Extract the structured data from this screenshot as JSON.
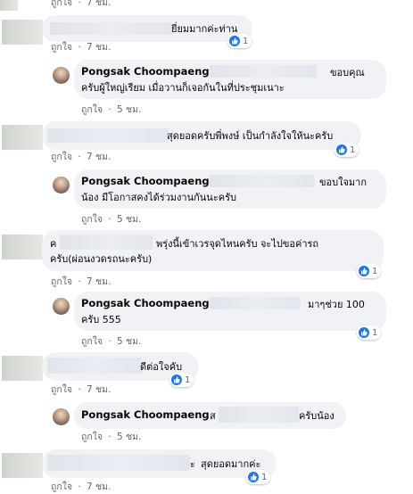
{
  "actions": {
    "like": "ถูกใจ",
    "dot": "·"
  },
  "comments": [
    {
      "type": "top",
      "text": "ยี่ยมมากค่ะท่าน",
      "time": "7 ชม.",
      "reactions": "1"
    },
    {
      "type": "reply",
      "name": "Pongsak Choompaeng",
      "line1": "ขอบคุณ",
      "line2": "ครับผู้ใหญ่เรียม เมื่อวานก็เจอกันในที่ประชุมเนาะ",
      "time": "5 ชม."
    },
    {
      "type": "top",
      "text": "สุดยอดครับพี่พงษ์ เป็นกำลังใจให้นะครับ",
      "time": "7 ชม.",
      "reactions": "1"
    },
    {
      "type": "reply",
      "name": "Pongsak Choompaeng",
      "line1": "ขอบใจมาก",
      "line2": "น้อง มีโอกาสคงได้ร่วมงานกันนะครับ",
      "time": "5 ชม."
    },
    {
      "type": "top",
      "prefix": "ค",
      "text": "พรุ่งนี้เข้าเวรจุดไหนครับ จะไปขอค่ารถ",
      "line2": "ครับ(ผ่อนงวดรถนะครับ)",
      "time": "7 ชม.",
      "reactions": "1"
    },
    {
      "type": "reply",
      "name": "Pongsak Choompaeng",
      "line1": "มาๆช่วย 100",
      "line2": "ครับ 555",
      "time": "5 ชม.",
      "reactions": "1"
    },
    {
      "type": "top",
      "text": "ดีต่อใจคับ",
      "time": "7 ชม.",
      "reactions": "1"
    },
    {
      "type": "reply",
      "name": "Pongsak Choompaeng",
      "prefix": "ส",
      "line1": "ครับน้อง",
      "time": "5 ชม."
    },
    {
      "type": "top",
      "prefix": "ะ",
      "text": "สุดยอดมากค่ะ",
      "time": "7 ชม.",
      "reactions": "1"
    }
  ],
  "colors": {
    "bubble": "#f0f2f5",
    "like_blue": "#1877f2",
    "meta": "#65676b"
  }
}
